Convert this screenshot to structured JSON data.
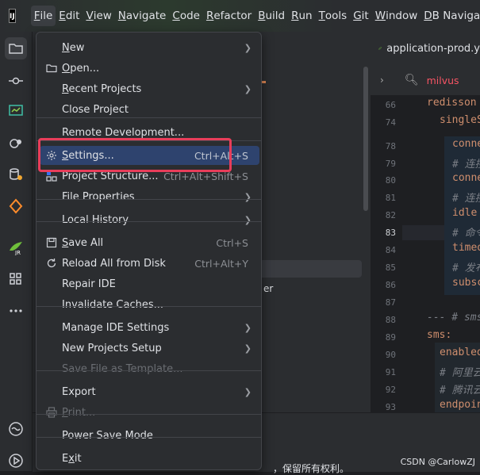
{
  "menubar": {
    "items": [
      {
        "label": "File",
        "mnemonic": "F",
        "rest": "ile"
      },
      {
        "label": "Edit",
        "mnemonic": "E",
        "rest": "dit"
      },
      {
        "label": "View",
        "mnemonic": "V",
        "rest": "iew"
      },
      {
        "label": "Navigate",
        "mnemonic": "N",
        "rest": "avigate"
      },
      {
        "label": "Code",
        "mnemonic": "C",
        "rest": "ode"
      },
      {
        "label": "Refactor",
        "mnemonic": "R",
        "rest": "efactor"
      },
      {
        "label": "Build",
        "mnemonic": "B",
        "rest": "uild"
      },
      {
        "label": "Run",
        "mnemonic": "R",
        "rest": "un"
      },
      {
        "label": "Tools",
        "mnemonic": "T",
        "rest": "ools"
      },
      {
        "label": "Git",
        "mnemonic": "G",
        "rest": "it"
      },
      {
        "label": "Window",
        "mnemonic": "W",
        "rest": "indow"
      },
      {
        "label": "DB Navigator",
        "mnemonic": "D",
        "rest": "B Navigator"
      }
    ]
  },
  "logo": {
    "text": "IJ"
  },
  "editor": {
    "tab_title": "application-prod.y",
    "find_query": "milvus",
    "line_numbers": [
      "66",
      "74",
      "78",
      "79",
      "80",
      "81",
      "82",
      "83",
      "84",
      "85",
      "86",
      "87",
      "88",
      "89",
      "90",
      "91",
      "92",
      "93"
    ],
    "code_lines": [
      {
        "text": "redisson",
        "type": "k"
      },
      {
        "text": "singleS",
        "type": "k"
      },
      {
        "text": "conne",
        "type": "k"
      },
      {
        "text": "# 连接",
        "type": "c"
      },
      {
        "text": "conne",
        "type": "k"
      },
      {
        "text": "# 连接",
        "type": "c"
      },
      {
        "text": "idle",
        "type": "k"
      },
      {
        "text": "# 命令",
        "type": "c"
      },
      {
        "text": "timeo",
        "type": "k"
      },
      {
        "text": "# 发布",
        "type": "c"
      },
      {
        "text": "subsc",
        "type": "k"
      },
      {
        "text": "",
        "type": "w"
      },
      {
        "text": "--- # sms",
        "type": "c"
      },
      {
        "text": "sms:",
        "type": "k"
      },
      {
        "text": "enabled",
        "type": "k"
      },
      {
        "text": "# 阿里云",
        "type": "c"
      },
      {
        "text": "# 腾讯云",
        "type": "c"
      },
      {
        "text": "endpoin",
        "type": "k"
      }
    ]
  },
  "background": {
    "partial_text": "er"
  },
  "file_menu": {
    "items": [
      {
        "id": "new",
        "label": "New",
        "mn": "N",
        "rest": "ew",
        "shortcut": "",
        "submenu": true,
        "icon": "",
        "disabled": false,
        "selected": false
      },
      {
        "id": "open",
        "label": "Open...",
        "mn": "O",
        "rest": "pen...",
        "shortcut": "",
        "submenu": false,
        "icon": "folder-icon",
        "disabled": false,
        "selected": false
      },
      {
        "id": "recent-projects",
        "label": "Recent Projects",
        "mn": "R",
        "rest": "ecent Projects",
        "shortcut": "",
        "submenu": true,
        "icon": "",
        "disabled": false,
        "selected": false
      },
      {
        "id": "close-project",
        "label": "Close Project",
        "mn": "",
        "rest": "Close Project",
        "shortcut": "",
        "submenu": false,
        "icon": "",
        "disabled": false,
        "selected": false
      },
      {
        "id": "remote-development",
        "label": "Remote Development...",
        "mn": "",
        "rest": "Remote Development...",
        "shortcut": "",
        "submenu": false,
        "icon": "",
        "disabled": false,
        "selected": false
      },
      {
        "id": "settings",
        "label": "Settings...",
        "mn": "S",
        "rest": "ettings...",
        "shortcut": "Ctrl+Alt+S",
        "submenu": false,
        "icon": "gear-icon",
        "disabled": false,
        "selected": true
      },
      {
        "id": "project-structure",
        "label": "Project Structure...",
        "mn": "",
        "rest": "Project Structure...",
        "shortcut": "Ctrl+Alt+Shift+S",
        "submenu": false,
        "icon": "project-structure-icon",
        "disabled": false,
        "selected": false
      },
      {
        "id": "file-properties",
        "label": "File Properties",
        "mn": "",
        "rest": "File Properties",
        "shortcut": "",
        "submenu": true,
        "icon": "",
        "disabled": false,
        "selected": false
      },
      {
        "id": "local-history",
        "label": "Local History",
        "mn": "",
        "rest": "Local History",
        "shortcut": "",
        "submenu": true,
        "icon": "",
        "disabled": false,
        "selected": false
      },
      {
        "id": "save-all",
        "label": "Save All",
        "mn": "S",
        "rest": "ave All",
        "shortcut": "Ctrl+S",
        "submenu": false,
        "icon": "save-icon",
        "disabled": false,
        "selected": false
      },
      {
        "id": "reload-all",
        "label": "Reload All from Disk",
        "mn": "",
        "rest": "Reload All from Disk",
        "shortcut": "Ctrl+Alt+Y",
        "submenu": false,
        "icon": "reload-icon",
        "disabled": false,
        "selected": false
      },
      {
        "id": "repair-ide",
        "label": "Repair IDE",
        "mn": "",
        "rest": "Repair IDE",
        "shortcut": "",
        "submenu": false,
        "icon": "",
        "disabled": false,
        "selected": false
      },
      {
        "id": "invalidate-caches",
        "label": "Invalidate Caches...",
        "mn": "",
        "rest": "Invalidate Caches...",
        "shortcut": "",
        "submenu": false,
        "icon": "",
        "disabled": false,
        "selected": false
      },
      {
        "id": "manage-ide-settings",
        "label": "Manage IDE Settings",
        "mn": "",
        "rest": "Manage IDE Settings",
        "shortcut": "",
        "submenu": true,
        "icon": "",
        "disabled": false,
        "selected": false
      },
      {
        "id": "new-projects-setup",
        "label": "New Projects Setup",
        "mn": "",
        "rest": "New Projects Setup",
        "shortcut": "",
        "submenu": true,
        "icon": "",
        "disabled": false,
        "selected": false
      },
      {
        "id": "save-file-as-template",
        "label": "Save File as Template...",
        "mn": "",
        "rest": "Save File as Template...",
        "shortcut": "",
        "submenu": false,
        "icon": "",
        "disabled": true,
        "selected": false
      },
      {
        "id": "export",
        "label": "Export",
        "mn": "",
        "rest": "Export",
        "shortcut": "",
        "submenu": true,
        "icon": "",
        "disabled": false,
        "selected": false
      },
      {
        "id": "print",
        "label": "Print...",
        "mn": "P",
        "rest": "rint...",
        "shortcut": "",
        "submenu": false,
        "icon": "print-icon",
        "disabled": true,
        "selected": false
      },
      {
        "id": "power-save-mode",
        "label": "Power Save Mode",
        "mn": "",
        "rest": "Power Save Mode",
        "shortcut": "",
        "submenu": false,
        "icon": "",
        "disabled": false,
        "selected": false
      },
      {
        "id": "exit",
        "label": "Exit",
        "mn": "x",
        "pre": "E",
        "rest": "it",
        "shortcut": "",
        "submenu": false,
        "icon": "",
        "disabled": false,
        "selected": false
      }
    ]
  },
  "footer": {
    "text": "，保留所有权利。"
  },
  "watermark": {
    "text": "CSDN @CarlowZJ"
  },
  "colors": {
    "accent_selection": "#2e436e",
    "highlight_box": "#e83d5a",
    "menu_bg": "#2b2d30"
  }
}
